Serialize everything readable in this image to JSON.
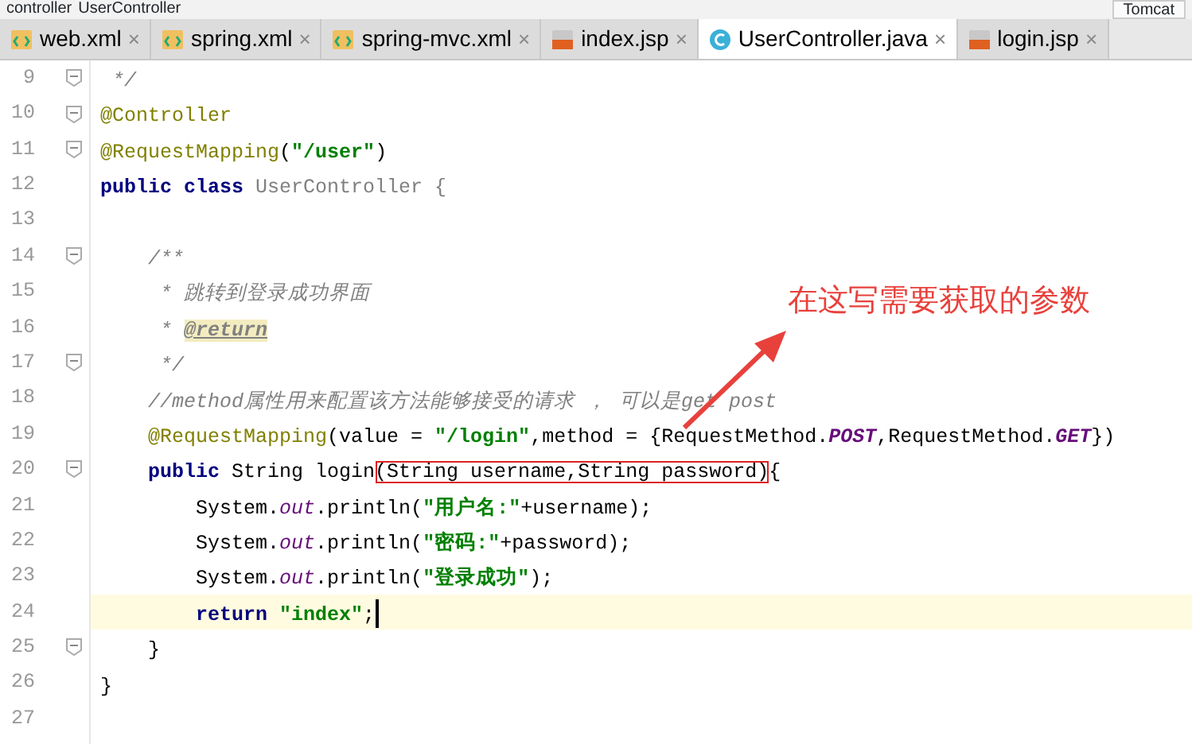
{
  "breadcrumb": [
    "controller",
    "UserController"
  ],
  "toolbar": {
    "run_config": "Tomcat"
  },
  "tabs": [
    {
      "label": "web.xml",
      "kind": "xml",
      "selected": false,
      "close": "×"
    },
    {
      "label": "spring.xml",
      "kind": "xml",
      "selected": false,
      "close": "×"
    },
    {
      "label": "spring-mvc.xml",
      "kind": "xml",
      "selected": false,
      "close": "×"
    },
    {
      "label": "index.jsp",
      "kind": "jsp",
      "selected": false,
      "close": "×"
    },
    {
      "label": "UserController.java",
      "kind": "java",
      "selected": true,
      "close": "×"
    },
    {
      "label": "login.jsp",
      "kind": "jsp",
      "selected": false,
      "close": "×"
    }
  ],
  "editor": {
    "lines": [
      {
        "number": "9",
        "fold": true,
        "current": false,
        "tokens": [
          {
            "kind": "comment",
            "t": " */"
          }
        ]
      },
      {
        "number": "10",
        "fold": true,
        "current": false,
        "tokens": [
          {
            "kind": "ann",
            "t": "@Controller"
          }
        ]
      },
      {
        "number": "11",
        "fold": true,
        "current": false,
        "tokens": [
          {
            "kind": "ann",
            "t": "@RequestMapping"
          },
          {
            "kind": "plain",
            "t": "("
          },
          {
            "kind": "str",
            "t": "\"/user\""
          },
          {
            "kind": "plain",
            "t": ")"
          }
        ]
      },
      {
        "number": "12",
        "fold": false,
        "current": false,
        "tokens": [
          {
            "kind": "kw",
            "t": "public class"
          },
          {
            "kind": "dim",
            "t": " UserController {"
          }
        ]
      },
      {
        "number": "13",
        "fold": false,
        "current": false
      },
      {
        "number": "14",
        "fold": true,
        "current": false,
        "tokens": [
          {
            "kind": "comment",
            "t": "    /**"
          }
        ]
      },
      {
        "number": "15",
        "fold": false,
        "current": false,
        "tokens": [
          {
            "kind": "comment",
            "t": "     * 跳转到登录成功界面"
          }
        ]
      },
      {
        "number": "16",
        "fold": false,
        "current": false,
        "tokens": [
          {
            "kind": "comment",
            "t": "     * "
          },
          {
            "kind": "doctag",
            "t": "@return"
          }
        ]
      },
      {
        "number": "17",
        "fold": true,
        "current": false,
        "tokens": [
          {
            "kind": "comment",
            "t": "     */"
          }
        ]
      },
      {
        "number": "18",
        "fold": false,
        "current": false,
        "tokens": [
          {
            "kind": "comment",
            "t": "    //method属性用来配置该方法能够接受的请求 ， 可以是get post"
          }
        ]
      },
      {
        "number": "19",
        "fold": false,
        "current": false,
        "tokens": [
          {
            "kind": "ann",
            "t": "    @RequestMapping"
          },
          {
            "kind": "plain",
            "t": "(value = "
          },
          {
            "kind": "str",
            "t": "\"/login\""
          },
          {
            "kind": "plain",
            "t": ",method = {RequestMethod."
          },
          {
            "kind": "const",
            "t": "POST"
          },
          {
            "kind": "plain",
            "t": ",RequestMethod."
          },
          {
            "kind": "const",
            "t": "GET"
          },
          {
            "kind": "plain",
            "t": "})"
          }
        ]
      },
      {
        "number": "20",
        "fold": true,
        "current": false,
        "tokens": [
          {
            "kind": "kw",
            "t": "    public"
          },
          {
            "kind": "plain",
            "t": " String login"
          },
          {
            "kind": "plain",
            "t": "(String username,String password)",
            "boxed": true
          },
          {
            "kind": "plain",
            "t": "{"
          }
        ]
      },
      {
        "number": "21",
        "fold": false,
        "current": false,
        "tokens": [
          {
            "kind": "plain",
            "t": "        System."
          },
          {
            "kind": "static",
            "t": "out"
          },
          {
            "kind": "plain",
            "t": ".println("
          },
          {
            "kind": "str",
            "t": "\"用户名:\""
          },
          {
            "kind": "plain",
            "t": "+username);"
          }
        ]
      },
      {
        "number": "22",
        "fold": false,
        "current": false,
        "tokens": [
          {
            "kind": "plain",
            "t": "        System."
          },
          {
            "kind": "static",
            "t": "out"
          },
          {
            "kind": "plain",
            "t": ".println("
          },
          {
            "kind": "str",
            "t": "\"密码:\""
          },
          {
            "kind": "plain",
            "t": "+password);"
          }
        ]
      },
      {
        "number": "23",
        "fold": false,
        "current": false,
        "tokens": [
          {
            "kind": "plain",
            "t": "        System."
          },
          {
            "kind": "static",
            "t": "out"
          },
          {
            "kind": "plain",
            "t": ".println("
          },
          {
            "kind": "str",
            "t": "\"登录成功\""
          },
          {
            "kind": "plain",
            "t": ");"
          }
        ]
      },
      {
        "number": "24",
        "fold": false,
        "current": true,
        "tokens": [
          {
            "kind": "kw",
            "t": "        return"
          },
          {
            "kind": "str",
            "t": " \"index\""
          },
          {
            "kind": "plain",
            "t": ";"
          }
        ]
      },
      {
        "number": "25",
        "fold": true,
        "current": false,
        "tokens": [
          {
            "kind": "plain",
            "t": "    }"
          }
        ]
      },
      {
        "number": "26",
        "fold": false,
        "current": false,
        "tokens": [
          {
            "kind": "plain",
            "t": "}"
          }
        ]
      },
      {
        "number": "27",
        "fold": false,
        "current": false
      }
    ]
  },
  "annotation": {
    "note": "在这写需要获取的参数"
  }
}
